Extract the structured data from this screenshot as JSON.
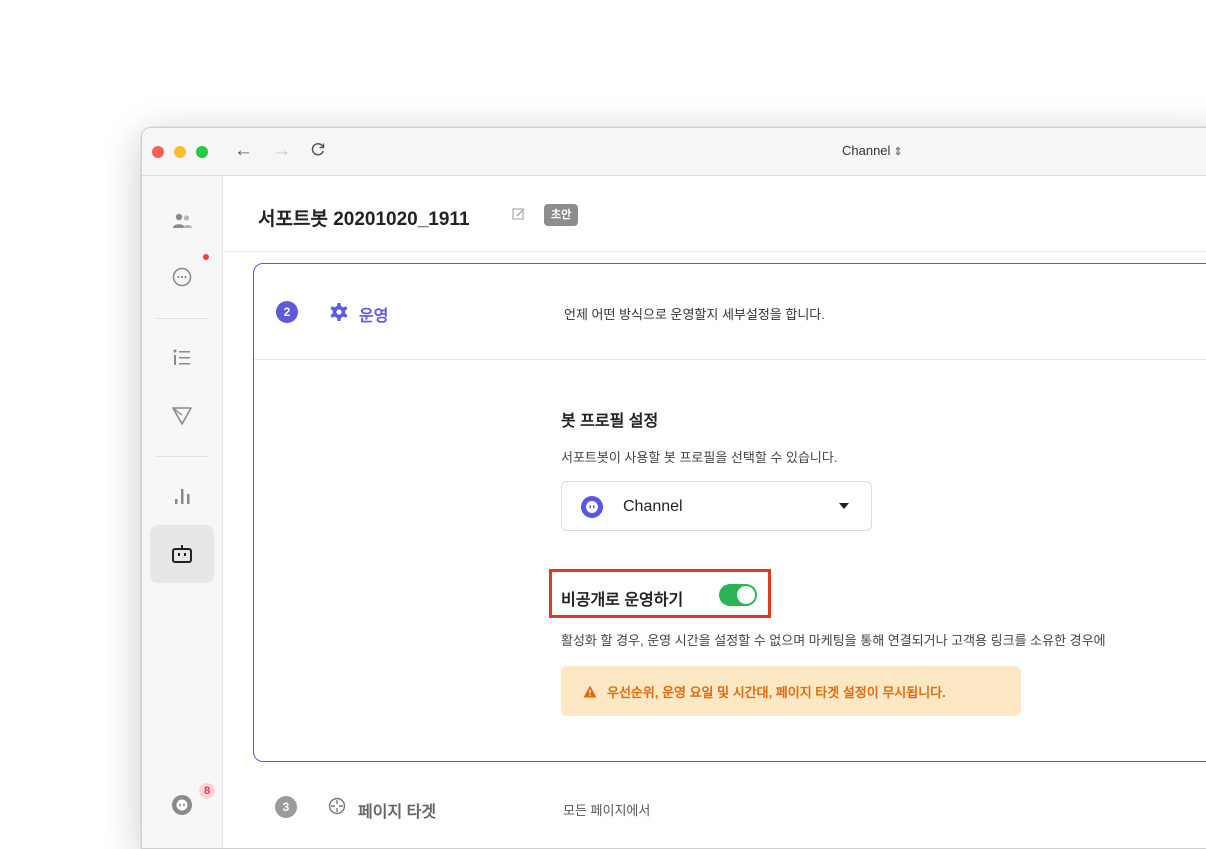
{
  "window": {
    "url_label": "Channel",
    "url_dropdown_glyph": "⇕"
  },
  "nav": {
    "back": "←",
    "forward": "→",
    "reload": "C"
  },
  "sidebar": {
    "items": [
      {
        "name": "users",
        "icon": "users-icon"
      },
      {
        "name": "chat",
        "icon": "chat-bubble-icon",
        "has_alert_dot": true
      },
      {
        "name": "list",
        "icon": "list-icon"
      },
      {
        "name": "send",
        "icon": "send-icon"
      },
      {
        "name": "stats",
        "icon": "bar-chart-icon"
      },
      {
        "name": "bot",
        "icon": "bot-icon",
        "active": true
      }
    ],
    "profile_badge": "8"
  },
  "header": {
    "title": "서포트봇 20201020_1911",
    "badge": "초안"
  },
  "step2": {
    "number": "2",
    "title": "운영",
    "description": "언제 어떤 방식으로 운영할지 세부설정을 합니다.",
    "profile_section": {
      "title": "봇 프로필 설정",
      "description": "서포트봇이 사용할 봇 프로필을 선택할 수 있습니다.",
      "selected_profile": "Channel"
    },
    "private_section": {
      "label": "비공개로 운영하기",
      "toggle_on": true,
      "description": "활성화 할 경우, 운영 시간을 설정할 수 없으며 마케팅을 통해 연결되거나 고객용 링크를 소유한 경우에",
      "warning": "우선순위, 운영 요일 및 시간대, 페이지 타겟 설정이 무시됩니다."
    }
  },
  "step3": {
    "number": "3",
    "title": "페이지 타겟",
    "description": "모든 페이지에서"
  },
  "colors": {
    "accent": "#5d5bd8",
    "toggle": "#29b553",
    "warning_bg": "#fde8c6",
    "warning_text": "#e06c10",
    "highlight": "#e23a1e"
  }
}
